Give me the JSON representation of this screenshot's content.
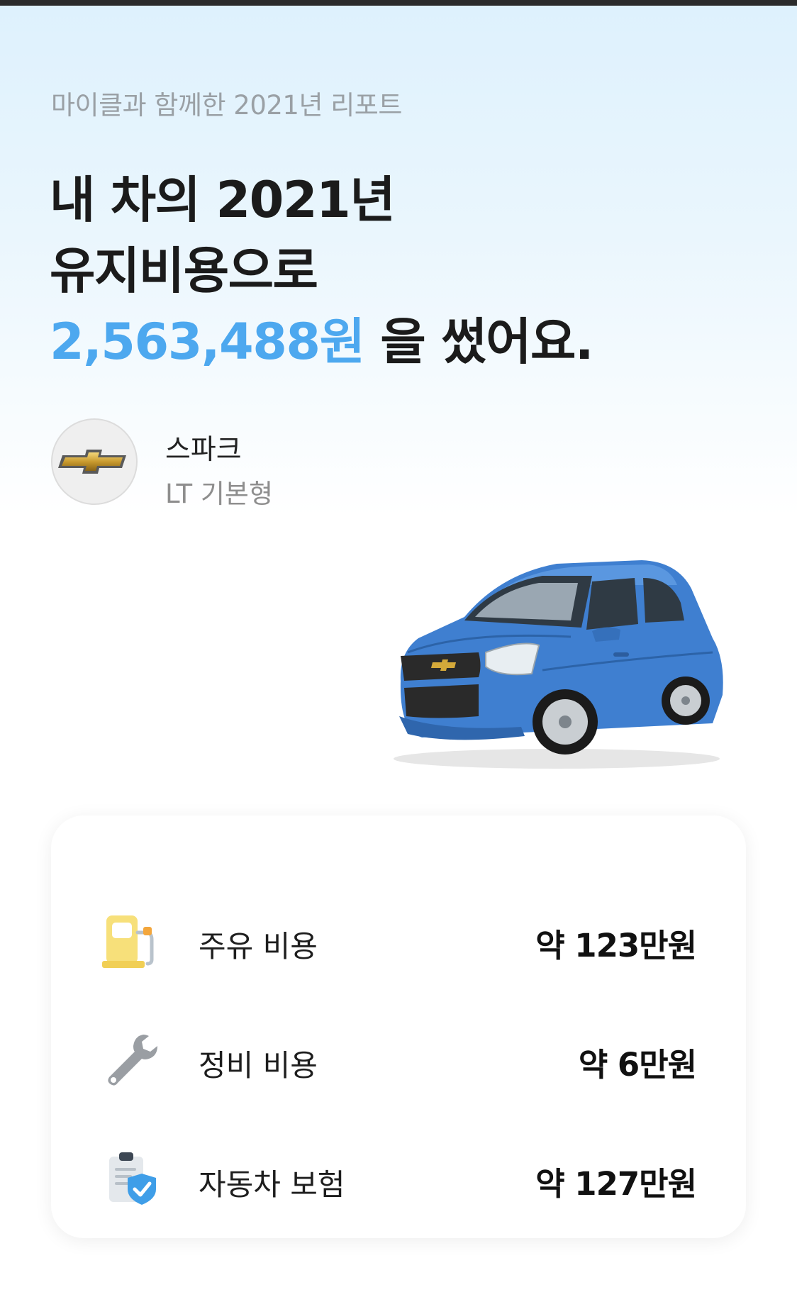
{
  "header": {
    "subtitle": "마이클과 함께한 2021년 리포트",
    "headline_line1": "내 차의 2021년",
    "headline_line2": "유지비용으로",
    "amount": "2,563,488원",
    "headline_suffix": " 을 썼어요."
  },
  "car": {
    "brand_icon": "chevrolet-bowtie-logo",
    "name": "스파크",
    "trim": "LT 기본형",
    "image_icon": "blue-hatchback-car"
  },
  "costs": [
    {
      "icon": "fuel-pump-icon",
      "label": "주유 비용",
      "value": "약 123만원"
    },
    {
      "icon": "wrench-icon",
      "label": "정비 비용",
      "value": "약 6만원"
    },
    {
      "icon": "insurance-shield-icon",
      "label": "자동차 보험",
      "value": "약 127만원"
    }
  ],
  "colors": {
    "accent": "#4da8ef",
    "car_body": "#3f7fd0"
  }
}
